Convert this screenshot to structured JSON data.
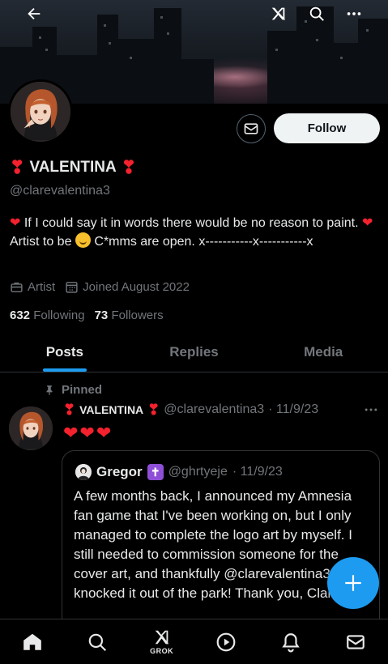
{
  "header": {
    "back_icon": "arrow-left-icon",
    "grok_icon": "grok-icon",
    "search_icon": "search-icon",
    "more_icon": "more-horizontal-icon"
  },
  "profile": {
    "display_name": "VALENTINA",
    "handle": "@clarevalentina3",
    "follow_label": "Follow",
    "bio_parts": {
      "p1": " If I could say it in words there would be no reason to paint. ",
      "p2": " Artist to be",
      "p3": " C*mms are open. x-----------x-----------x"
    },
    "profession": "Artist",
    "joined": "Joined August 2022",
    "following_count": "632",
    "following_label": "Following",
    "followers_count": "73",
    "followers_label": "Followers"
  },
  "tabs": [
    "Posts",
    "Replies",
    "Media"
  ],
  "pinned_tweet": {
    "pinned_label": "Pinned",
    "author_name": "VALENTINA",
    "author_handle": "@clarevalentina3",
    "date": "· 11/9/23",
    "hearts": "❤❤❤",
    "quote": {
      "name": "Gregor",
      "badge": "✝",
      "handle": "@ghrtyeje",
      "date": "· 11/9/23",
      "text": "A few months back, I announced my Amnesia fan game that I've been working on, but I only managed to complete the logo art by myself. I still needed to commission someone for the cover art, and thankfully @clarevalentina3 knocked it out of the park! Thank you, Clare ^^"
    }
  },
  "bottom_nav": {
    "grok_label": "GROK"
  },
  "colors": {
    "accent": "#1d9bf0",
    "heart": "#f4212e",
    "muted": "#71767b",
    "border": "#2f3336"
  }
}
